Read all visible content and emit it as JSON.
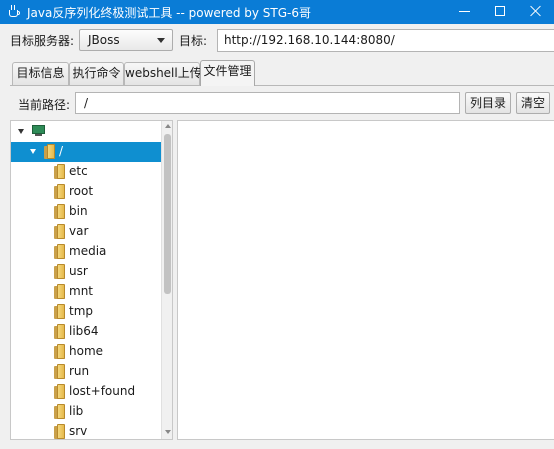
{
  "window": {
    "title": "Java反序列化终极测试工具  -- powered by STG-6哥",
    "controls": {
      "minimize_icon": "minimize-icon",
      "maximize_icon": "maximize-icon",
      "close_icon": "close-icon"
    }
  },
  "header": {
    "server_label": "目标服务器:",
    "server_value": "JBoss",
    "target_label": "目标:",
    "target_value": "http://192.168.10.144:8080/"
  },
  "tabs": [
    {
      "label": "目标信息",
      "active": false
    },
    {
      "label": "执行命令",
      "active": false
    },
    {
      "label": "webshell上传",
      "active": false
    },
    {
      "label": "文件管理",
      "active": true
    }
  ],
  "path_bar": {
    "label": "当前路径:",
    "value": "/",
    "list_button": "列目录",
    "clear_button": "清空"
  },
  "tree": {
    "root_icon": "computer-icon",
    "selected": {
      "label": "/"
    },
    "children": [
      "etc",
      "root",
      "bin",
      "var",
      "media",
      "usr",
      "mnt",
      "tmp",
      "lib64",
      "home",
      "run",
      "lost+found",
      "lib",
      "srv"
    ]
  },
  "colors": {
    "titlebar": "#0a7cd6",
    "selection": "#0f8fd0",
    "folder": "#e6b94c"
  }
}
